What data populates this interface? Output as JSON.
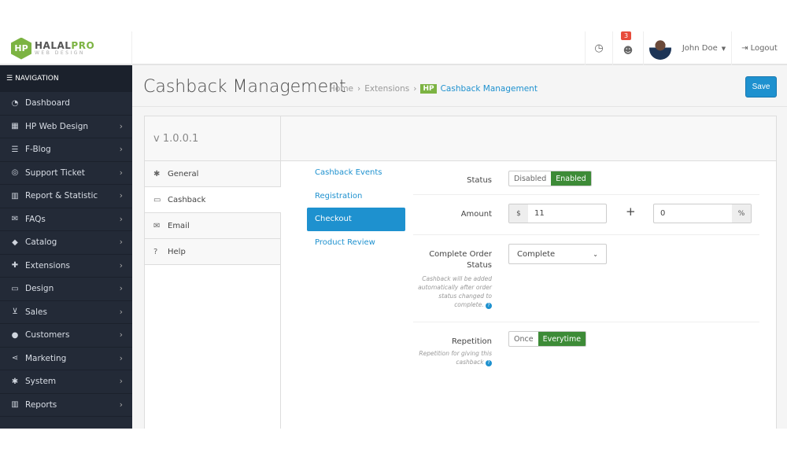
{
  "logo": {
    "mark": "HP",
    "brand_a": "HALAL",
    "brand_b": "PRO",
    "tagline": "WEB DESIGN"
  },
  "header": {
    "notification_count": "3",
    "user_name": "John Doe",
    "logout": "Logout"
  },
  "sidebar": {
    "title": "NAVIGATION",
    "items": [
      {
        "label": "Dashboard",
        "icon": "dashboard-icon",
        "glyph": "◔",
        "chev": false
      },
      {
        "label": "HP Web Design",
        "icon": "windows-icon",
        "glyph": "▦",
        "chev": true
      },
      {
        "label": "F-Blog",
        "icon": "list-icon",
        "glyph": "☰",
        "chev": true
      },
      {
        "label": "Support Ticket",
        "icon": "support-icon",
        "glyph": "◎",
        "chev": true
      },
      {
        "label": "Report & Statistic",
        "icon": "bar-chart-icon",
        "glyph": "▥",
        "chev": true
      },
      {
        "label": "FAQs",
        "icon": "comments-icon",
        "glyph": "✉",
        "chev": true
      },
      {
        "label": "Catalog",
        "icon": "tags-icon",
        "glyph": "◆",
        "chev": true
      },
      {
        "label": "Extensions",
        "icon": "puzzle-icon",
        "glyph": "✚",
        "chev": true
      },
      {
        "label": "Design",
        "icon": "monitor-icon",
        "glyph": "▭",
        "chev": true
      },
      {
        "label": "Sales",
        "icon": "cart-icon",
        "glyph": "⊻",
        "chev": true
      },
      {
        "label": "Customers",
        "icon": "user-icon",
        "glyph": "●",
        "chev": true
      },
      {
        "label": "Marketing",
        "icon": "share-icon",
        "glyph": "⋖",
        "chev": true
      },
      {
        "label": "System",
        "icon": "cog-icon",
        "glyph": "✱",
        "chev": true
      },
      {
        "label": "Reports",
        "icon": "bar-chart-icon",
        "glyph": "▥",
        "chev": true
      }
    ]
  },
  "page": {
    "title": "Cashback Management",
    "breadcrumb": [
      "Home",
      "Extensions"
    ],
    "breadcrumb_badge": "HP",
    "breadcrumb_current": "Cashback Management",
    "save": "Save"
  },
  "panel": {
    "version": "v 1.0.0.1",
    "tabs": [
      {
        "label": "General",
        "glyph": "✱"
      },
      {
        "label": "Cashback",
        "glyph": "▭"
      },
      {
        "label": "Email",
        "glyph": "✉"
      },
      {
        "label": "Help",
        "glyph": "?"
      }
    ],
    "subnav": [
      "Cashback Events",
      "Registration",
      "Checkout",
      "Product Review"
    ]
  },
  "form": {
    "status": {
      "label": "Status",
      "off": "Disabled",
      "on": "Enabled"
    },
    "amount": {
      "label": "Amount",
      "prefix": "$",
      "fixed": "11",
      "plus": "+",
      "percent": "0",
      "suffix": "%"
    },
    "order_status": {
      "label": "Complete Order Status",
      "value": "Complete",
      "help": "Cashback will be added automatically after order status changed to complete."
    },
    "repetition": {
      "label": "Repetition",
      "off": "Once",
      "on": "Everytime",
      "help": "Repetition for giving this cashback"
    }
  },
  "colors": {
    "primary": "#1e91cf",
    "success": "#3d8b37",
    "brand": "#7cb342",
    "sidebar": "#232a37"
  }
}
